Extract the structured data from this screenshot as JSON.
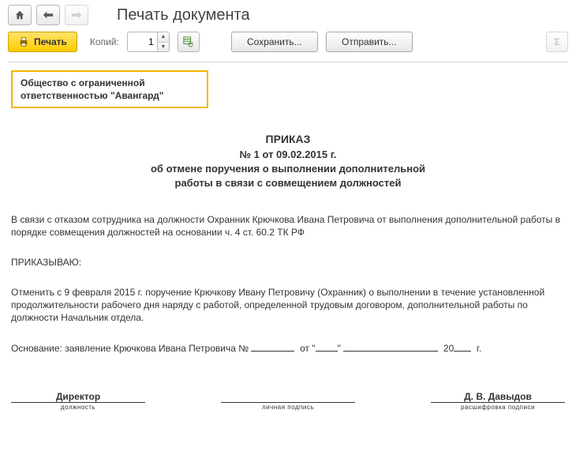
{
  "header": {
    "title": "Печать документа"
  },
  "toolbar": {
    "print_label": "Печать",
    "copies_label": "Копий:",
    "copies_value": "1",
    "save_label": "Сохранить...",
    "send_label": "Отправить...",
    "sum_label": "Σ"
  },
  "document": {
    "org_line1": "Общество с ограниченной",
    "org_line2": "ответственностью \"Авангард\"",
    "caption": "ПРИКАЗ",
    "number_date": "№ 1 от 09.02.2015 г.",
    "subtitle_line1": "об отмене поручения о выполнении дополнительной",
    "subtitle_line2": "работы в связи с совмещением должностей",
    "preamble": "В связи с отказом сотрудника на должности Охранник Крючкова Ивана Петровича от выполнения дополнительной работы в порядке совмещения должностей на основании ч. 4 ст. 60.2 ТК РФ",
    "order_word": "ПРИКАЗЫВАЮ:",
    "order_text": "Отменить с 9 февраля 2015 г. поручение Крючкову Ивану Петровичу (Охранник) о выполнении в течение установленной продолжительности рабочего дня наряду с работой, определенной трудовым договором, дополнительной работы по должности Начальник отдела.",
    "basis_prefix": "Основание: заявление Крючкова Ивана Петровича №",
    "basis_date_from_label": "от",
    "basis_year_suffix": "20",
    "basis_year_char": "г.",
    "sign": {
      "position_value": "Директор",
      "position_caption": "должность",
      "personal_caption": "личная подпись",
      "decipher_value": "Д. В. Давыдов",
      "decipher_caption": "расшифровка подписи"
    }
  }
}
